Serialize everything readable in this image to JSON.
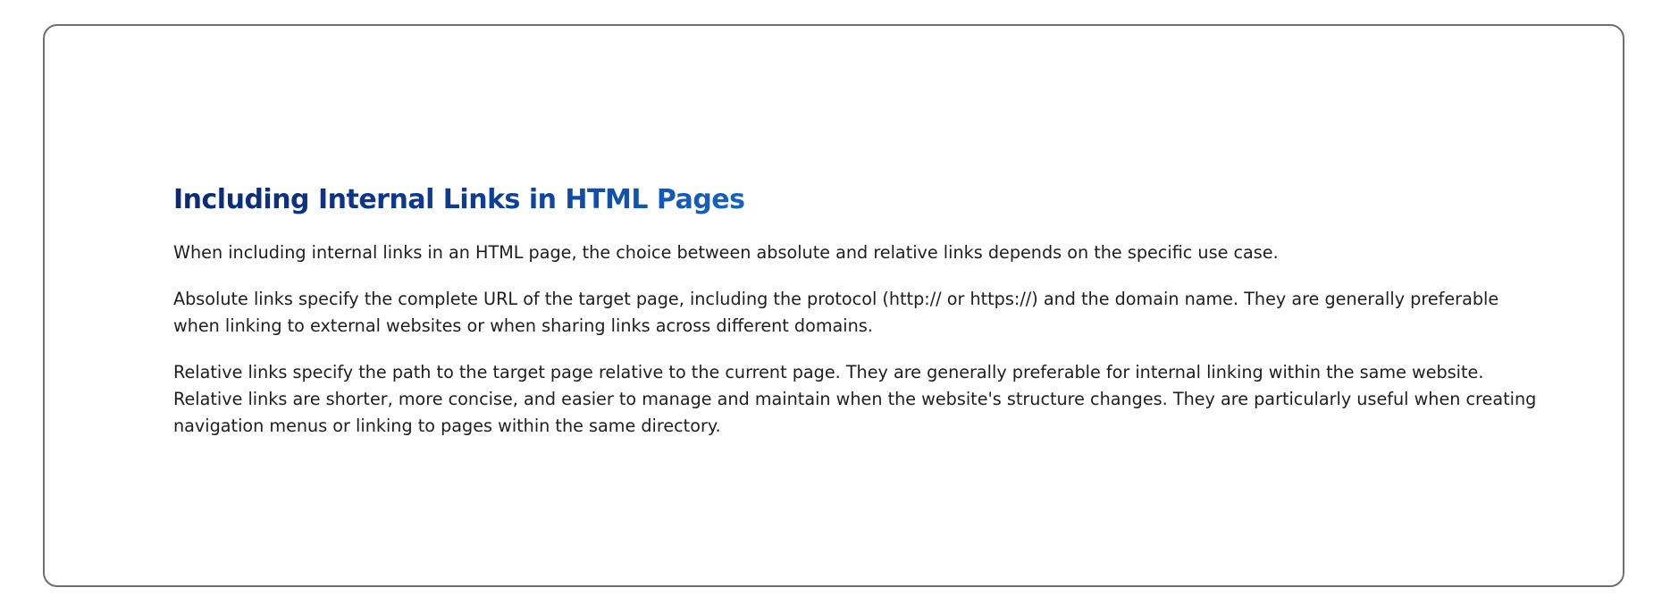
{
  "article": {
    "title": "Including Internal Links in HTML Pages",
    "paragraphs": [
      "When including internal links in an HTML page, the choice between absolute and relative links depends on the specific use case.",
      "Absolute links specify the complete URL of the target page, including the protocol (http:// or https://) and the domain name. They are generally preferable when linking to external websites or when sharing links across different domains.",
      "Relative links specify the path to the target page relative to the current page. They are generally preferable for internal linking within the same website. Relative links are shorter, more concise, and easier to manage and maintain when the website's structure changes. They are particularly useful when creating navigation menus or linking to pages within the same directory."
    ]
  },
  "colors": {
    "title_gradient_start": "#0b2a78",
    "title_gradient_end": "#1565c0",
    "body_text": "#1e1e1e",
    "card_border": "#6e6e6e"
  }
}
